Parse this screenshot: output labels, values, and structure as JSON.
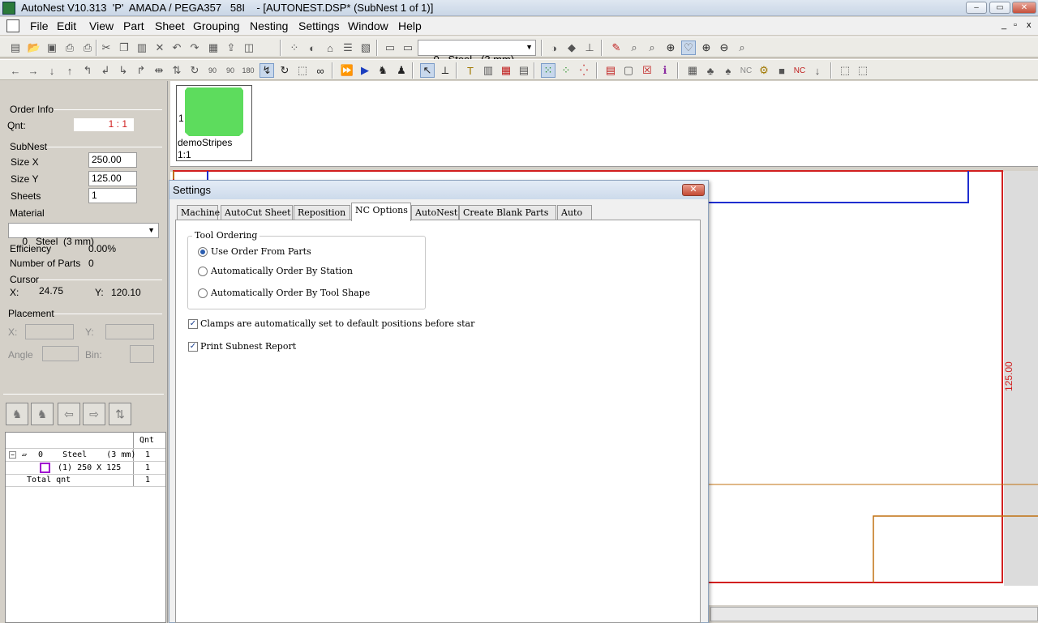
{
  "window": {
    "title": "AutoNest V10.313  'P'  AMADA / PEGA357   58I    - [AUTONEST.DSP* (SubNest 1 of 1)]",
    "controls": {
      "minimize": "–",
      "maximize": "▭",
      "close": "✕"
    }
  },
  "menu": {
    "items": [
      "File",
      "Edit",
      "View",
      "Part",
      "Sheet",
      "Grouping",
      "Nesting",
      "Settings",
      "Window",
      "Help"
    ],
    "mdi": {
      "minimize": "_",
      "restore": "▫",
      "close": "x"
    }
  },
  "toolbar": {
    "material_index": "0",
    "material_name": "Steel   (3 mm)"
  },
  "left_panel": {
    "order_info": {
      "label": "Order Info",
      "qnt_label": "Qnt:",
      "qnt_value": "1 : 1"
    },
    "subnest": {
      "label": "SubNest",
      "size_x_label": "Size X",
      "size_x": "250.00",
      "size_y_label": "Size Y",
      "size_y": "125.00",
      "sheets_label": "Sheets",
      "sheets": "1"
    },
    "material": {
      "label": "Material",
      "value": "0   Steel  (3 mm)"
    },
    "efficiency": {
      "label": "Efficiency",
      "value": "0.00%"
    },
    "num_parts": {
      "label": "Number of Parts",
      "value": "0"
    },
    "cursor": {
      "label": "Cursor",
      "x_label": "X:",
      "x": "24.75",
      "y_label": "Y:",
      "y": "120.10"
    },
    "placement": {
      "label": "Placement",
      "x_label": "X:",
      "y_label": "Y:",
      "angle_label": "Angle",
      "bin_label": "Bin:"
    },
    "tree": {
      "qnt_header": "Qnt",
      "rows": [
        {
          "text": "0    Steel    (3 mm)",
          "qnt": "1"
        },
        {
          "text": "(1) 250 X 125",
          "qnt": "1"
        },
        {
          "text": "Total qnt",
          "qnt": "1"
        }
      ]
    }
  },
  "thumbnail": {
    "count": "1",
    "name": "demoStripes",
    "ratio": "1:1",
    "color": "#5ddc5d"
  },
  "canvas": {
    "dimension_label": "125.00"
  },
  "dialog": {
    "title": "Settings",
    "close": "✕",
    "tabs": [
      "Machine",
      "AutoCut Sheet",
      "Reposition",
      "NC Options",
      "AutoNest",
      "Create Blank Parts",
      "Auto"
    ],
    "active_tab": "NC Options",
    "tool_ordering": {
      "label": "Tool Ordering",
      "options": [
        "Use Order From Parts",
        "Automatically Order By Station",
        "Automatically Order By Tool Shape"
      ],
      "selected": 0
    },
    "checks": [
      {
        "label": "Clamps are automatically set to default positions before star",
        "checked": true
      },
      {
        "label": "Print Subnest Report",
        "checked": true
      }
    ]
  }
}
